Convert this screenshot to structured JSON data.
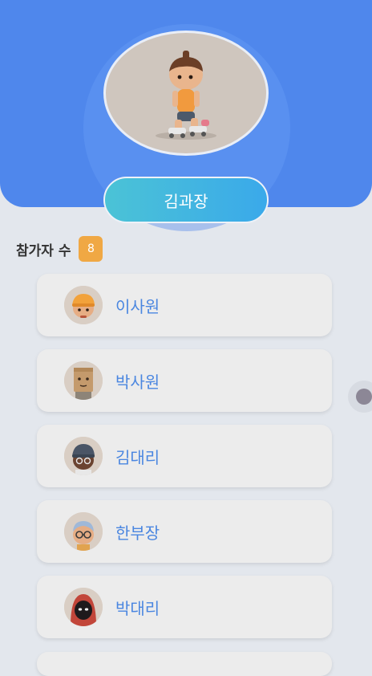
{
  "host": {
    "name": "김과장",
    "avatar_icon": "character-skater-icon"
  },
  "participants": {
    "label": "참가자 수",
    "count": "8",
    "items": [
      {
        "name": "이사원",
        "avatar_icon": "avatar-cap-icon"
      },
      {
        "name": "박사원",
        "avatar_icon": "avatar-paperbag-icon"
      },
      {
        "name": "김대리",
        "avatar_icon": "avatar-dark-cap-icon"
      },
      {
        "name": "한부장",
        "avatar_icon": "avatar-glasses-icon"
      },
      {
        "name": "박대리",
        "avatar_icon": "avatar-hood-icon"
      }
    ]
  },
  "colors": {
    "header": "#4f87ec",
    "name_pill_start": "#4bc3d6",
    "name_pill_end": "#3aa9ea",
    "badge": "#f0a844",
    "participant_name": "#4a86e0"
  }
}
